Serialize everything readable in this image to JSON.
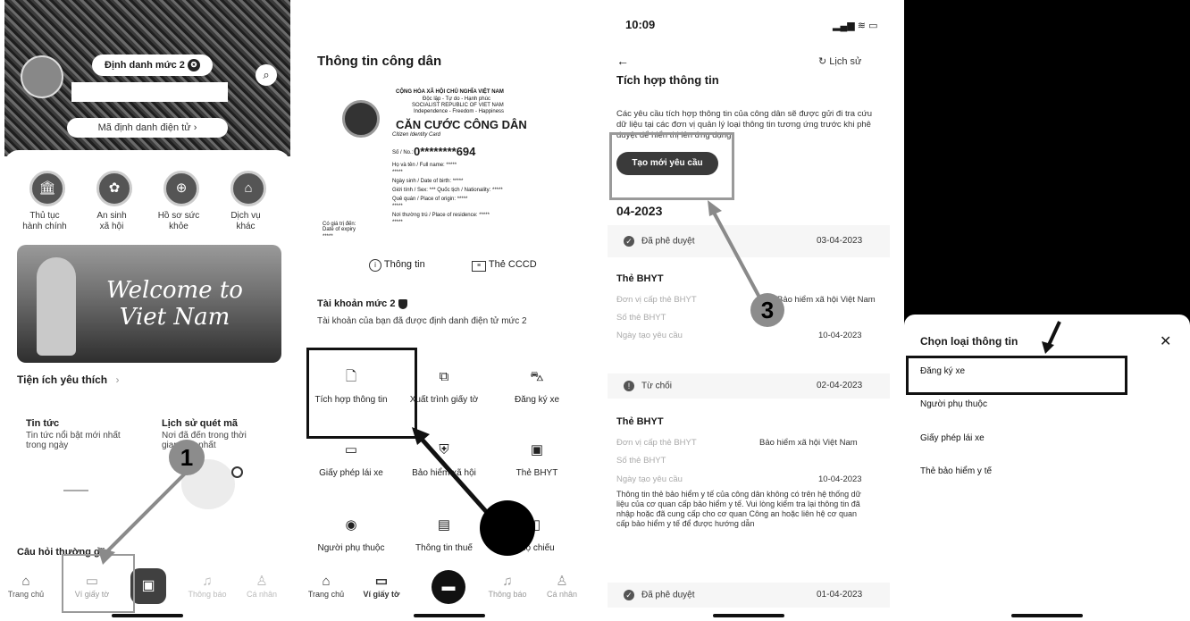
{
  "panel1": {
    "level_badge": "Định danh mức 2",
    "id_code_label": "Mã định danh điện tử",
    "services": [
      {
        "label": "Thủ tục\nhành chính",
        "icon": "government-building-icon",
        "glyph": "🏛"
      },
      {
        "label": "An sinh\nxã hội",
        "icon": "social-security-icon",
        "glyph": "✿"
      },
      {
        "label": "Hồ sơ sức\nkhỏe",
        "icon": "health-record-icon",
        "glyph": "⊕"
      },
      {
        "label": "Dịch vụ\nkhác",
        "icon": "other-services-icon",
        "glyph": "⌂"
      }
    ],
    "banner_text": "Welcome to\nViet Nam",
    "favorites_title": "Tiện ích yêu thích",
    "favorites_chevron": "›",
    "fav_cards": [
      {
        "title": "Tin tức",
        "desc": "Tin tức nổi bật mới nhất\ntrong ngày"
      },
      {
        "title": "Lịch sử quét mã",
        "desc": "Nơi đã đến trong thời\ngian gần nhất"
      }
    ],
    "faq_title": "Câu hỏi thường gặp",
    "annotation": "1",
    "nav": [
      "Trang chủ",
      "Ví giấy tờ",
      "",
      "Thông báo",
      "Cá nhân"
    ]
  },
  "panel2": {
    "title": "Thông tin công dân",
    "card": {
      "country_vn": "CỘNG HÒA XÃ HỘI CHỦ NGHĨA VIỆT NAM",
      "motto_vn": "Độc lập - Tự do - Hạnh phúc",
      "country_en": "SOCIALIST REPUBLIC OF VIET NAM",
      "motto_en": "Independence - Freedom - Happiness",
      "card_title": "CĂN CƯỚC CÔNG DÂN",
      "card_subtitle": "Citizen Identity Card",
      "number_label": "Số / No.:",
      "number": "0********694",
      "name_line": "Họ và tên / Full name:  *****",
      "name_value": "*****",
      "dob_line": "Ngày sinh / Date of birth:  *****",
      "sex_line": "Giới tính / Sex:  ***    Quốc tịch / Nationality:  *****",
      "origin_line": "Quê quán / Place of origin:  *****",
      "origin_value": "*****",
      "residence_line": "Nơi thường trú / Place of residence:  *****",
      "residence_value": "*****",
      "expiry_label": "Có giá trị đến:\nDate of expiry",
      "expiry_value": "*****"
    },
    "tab_info": "Thông tin",
    "tab_cccd": "Thẻ CCCD",
    "account_title": "Tài khoản mức 2",
    "account_desc": "Tài khoản của bạn đã được định danh điện tử mức 2",
    "grid": [
      {
        "label": "Tích hợp thông tin",
        "icon": "file-add-icon",
        "glyph": "🗋"
      },
      {
        "label": "Xuất trình giấy tờ",
        "icon": "present-docs-icon",
        "glyph": "⧉"
      },
      {
        "label": "Đăng ký xe",
        "icon": "car-icon",
        "glyph": "⛍"
      },
      {
        "label": "Giấy phép lái xe",
        "icon": "driver-license-icon",
        "glyph": "▭"
      },
      {
        "label": "Bảo hiểm xã hội",
        "icon": "social-insurance-icon",
        "glyph": "⛨"
      },
      {
        "label": "Thẻ BHYT",
        "icon": "health-card-icon",
        "glyph": "▣"
      },
      {
        "label": "Người phụ thuộc",
        "icon": "dependent-icon",
        "glyph": "◉"
      },
      {
        "label": "Thông tin thuế",
        "icon": "tax-icon",
        "glyph": "▤"
      },
      {
        "label": "Hộ chiếu",
        "icon": "passport-icon",
        "glyph": "▯"
      }
    ],
    "nav": [
      "Trang chủ",
      "Ví giấy tờ",
      "",
      "Thông báo",
      "Cá nhân"
    ]
  },
  "panel3": {
    "time": "10:09",
    "history": "Lịch sử",
    "title": "Tích hợp thông tin",
    "desc": "Các yêu cầu tích hợp thông tin của công dân sẽ được gửi đi tra cứu dữ liệu tại các đơn vị quản lý loại thông tin tương ứng trước khi phê duyệt để hiển thị lên ứng dụng",
    "create_button": "Tạo mới yêu cầu",
    "month": "04-2023",
    "annotation": "3",
    "entries": [
      {
        "status": "Đã phê duyệt",
        "date": "03-04-2023"
      },
      {
        "status": "Từ chối",
        "date": "02-04-2023"
      },
      {
        "status": "Đã phê duyệt",
        "date": "01-04-2023"
      }
    ],
    "card1": {
      "title": "Thẻ BHYT",
      "issuer_label": "Đơn vị cấp thẻ BHYT",
      "issuer_value": "Bảo hiểm xã hội Việt Nam",
      "number_label": "Số thẻ BHYT",
      "created_label": "Ngày tạo yêu cầu",
      "created_value": "10-04-2023"
    },
    "card2": {
      "title": "Thẻ BHYT",
      "issuer_label": "Đơn vị cấp thẻ BHYT",
      "issuer_value": "Bảo hiểm xã hội Việt Nam",
      "number_label": "Số thẻ BHYT",
      "created_label": "Ngày tạo yêu cầu",
      "created_value": "10-04-2023",
      "note": "Thông tin thẻ bảo hiểm y tế của công dân không có trên hệ thống dữ liệu của cơ quan cấp bảo hiểm y tế. Vui lòng kiểm tra lại thông tin đã nhập hoặc đã cung cấp cho cơ quan Công an hoặc liên hệ cơ quan cấp bảo hiểm y tế để được hướng dẫn"
    }
  },
  "panel4": {
    "sheet_title": "Chọn loại thông tin",
    "close": "✕",
    "options": [
      "Đăng ký xe",
      "Người phụ thuộc",
      "Giấy phép lái xe",
      "Thẻ bảo hiểm y tế"
    ]
  },
  "colors": {
    "accent_dark": "#3a3a3a",
    "annotation_gray": "#8c8c8c",
    "highlight_border": "#111111"
  }
}
